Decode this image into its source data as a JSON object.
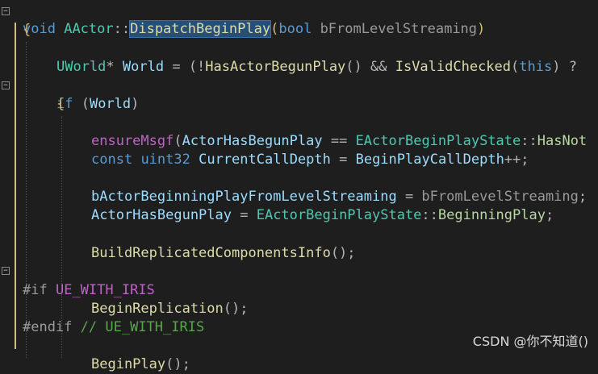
{
  "editor": {
    "fn_void": "void",
    "fn_class": "AActor",
    "fn_sep": "::",
    "fn_name": "DispatchBeginPlay",
    "fn_open": "(",
    "fn_param_type": "bool",
    "fn_param": "bFromLevelStreaming",
    "fn_close": ")",
    "brace_open": "{",
    "l3_type": "UWorld",
    "l3_star": "*",
    "l3_var": "World",
    "l3_eq": " = (!",
    "l3_call1": "HasActorBegunPlay",
    "l3_p1": "() && ",
    "l3_call2": "IsValidChecked",
    "l3_p2": "(",
    "l3_this": "this",
    "l3_p3": ") ?",
    "l5_if": "if",
    "l5_open": " (",
    "l5_var": "World",
    "l5_close": ")",
    "l6_brace": "{",
    "l7_macro": "ensureMsgf",
    "l7_open": "(",
    "l7_var": "ActorHasBegunPlay",
    "l7_eq": " == ",
    "l7_enum": "EActorBeginPlayState",
    "l7_sep": "::",
    "l7_val": "HasNot",
    "l8_const": "const",
    "l8_type": "uint32",
    "l8_var": "CurrentCallDepth",
    "l8_eq": " = ",
    "l8_rhs": "BeginPlayCallDepth",
    "l8_inc": "++;",
    "l10_var": "bActorBeginningPlayFromLevelStreaming",
    "l10_eq": " = ",
    "l10_rhs": "bFromLevelStreaming",
    "l10_end": ";",
    "l11_var": "ActorHasBegunPlay",
    "l11_eq": " = ",
    "l11_enum": "EActorBeginPlayState",
    "l11_sep": "::",
    "l11_val": "BeginningPlay",
    "l11_end": ";",
    "l13_call": "BuildReplicatedComponentsInfo",
    "l13_end": "();",
    "l15_if": "#if",
    "l15_macro": "UE_WITH_IRIS",
    "l16_call": "BeginReplication",
    "l16_end": "();",
    "l17_endif": "#endif",
    "l17_comment": "// UE_WITH_IRIS",
    "l19_call": "BeginPlay",
    "l19_end": "();"
  },
  "watermark": "CSDN @你不知道()",
  "colors": {
    "background": "#1e1e1e",
    "keyword": "#569cd6",
    "function": "#dcdcaa",
    "type": "#4ec9b0",
    "variable": "#9cdcfe",
    "macro": "#bd63c5",
    "selection": "#264f78"
  }
}
